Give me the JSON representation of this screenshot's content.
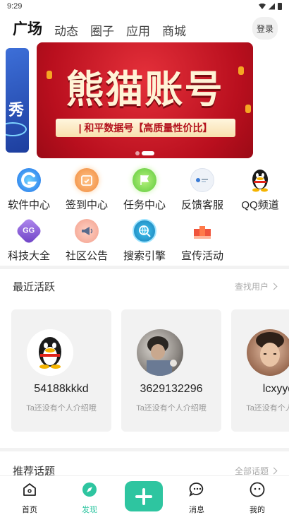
{
  "status_bar": {
    "time": "9:29"
  },
  "top_nav": {
    "tabs": [
      {
        "label": "广场",
        "active": true
      },
      {
        "label": "动态",
        "active": false
      },
      {
        "label": "圈子",
        "active": false
      },
      {
        "label": "应用",
        "active": false
      },
      {
        "label": "商城",
        "active": false
      }
    ],
    "login_label": "登录"
  },
  "banner": {
    "left_card_text": "秀",
    "title": "熊猫账号",
    "subtitle": "| 和平数据号【高质量性价比】",
    "active_slide": 2,
    "slide_count": 2
  },
  "grid": {
    "items": [
      {
        "label": "软件中心",
        "icon": "app-store-icon",
        "color": "#2f8cf0"
      },
      {
        "label": "签到中心",
        "icon": "calendar-check-icon",
        "color": "#f5a15a"
      },
      {
        "label": "任务中心",
        "icon": "flag-icon",
        "color": "#7ed957"
      },
      {
        "label": "反馈客服",
        "icon": "feedback-icon",
        "color": "#e9eef5"
      },
      {
        "label": "QQ频道",
        "icon": "qq-penguin-icon",
        "color": "#222222"
      },
      {
        "label": "科技大全",
        "icon": "tech-badge-icon",
        "color": "#8a5fd6"
      },
      {
        "label": "社区公告",
        "icon": "megaphone-icon",
        "color": "#f08c7a"
      },
      {
        "label": "搜索引擎",
        "icon": "globe-search-icon",
        "color": "#2aa6d8"
      },
      {
        "label": "宣传活动",
        "icon": "promo-icon",
        "color": "#f0543c"
      }
    ]
  },
  "recent": {
    "title": "最近活跃",
    "link_label": "查找用户",
    "users": [
      {
        "name": "54188kkkd",
        "bio": "Ta还没有个人介绍哦",
        "avatar": "qq-penguin-avatar"
      },
      {
        "name": "3629132296",
        "bio": "Ta还没有个人介绍哦",
        "avatar": "photo-avatar"
      },
      {
        "name": "lcxyyds",
        "bio": "Ta还没有个人介绍哦",
        "avatar": "photo-avatar"
      }
    ]
  },
  "topics": {
    "title": "推荐话题",
    "link_label": "全部话题"
  },
  "tab_bar": {
    "items": [
      {
        "label": "首页",
        "icon": "home-icon",
        "active": false
      },
      {
        "label": "发现",
        "icon": "compass-icon",
        "active": true
      },
      {
        "label": "消息",
        "icon": "message-icon",
        "active": false
      },
      {
        "label": "我的",
        "icon": "profile-icon",
        "active": false
      }
    ],
    "accent": "#2ec5a0"
  }
}
